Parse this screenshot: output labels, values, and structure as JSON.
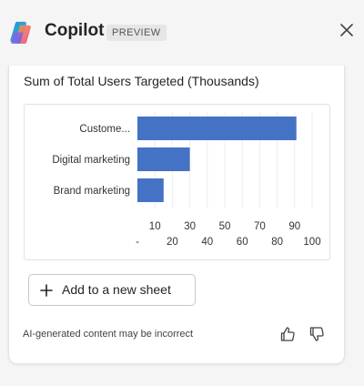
{
  "header": {
    "title": "Copilot",
    "badge": "PREVIEW",
    "icons": {
      "logo": "copilot-logo",
      "close": "close-icon"
    }
  },
  "chart_section": {
    "title": "Sum of Total Users Targeted (Thousands)"
  },
  "chart_data": {
    "type": "bar",
    "orientation": "horizontal",
    "title": "Sum of Total Users Targeted (Thousands)",
    "categories": [
      "Custome...",
      "Digital marketing",
      "Brand marketing"
    ],
    "values": [
      91,
      30,
      15
    ],
    "xlim": [
      0,
      100
    ],
    "x_ticks_row1": [
      "10",
      "30",
      "50",
      "70",
      "90"
    ],
    "x_ticks_row2": [
      "-",
      "20",
      "40",
      "60",
      "80",
      "100"
    ],
    "bar_color": "#4472c4",
    "grid": true
  },
  "actions": {
    "add_to_sheet": "Add to a new sheet",
    "add_icon": "plus-icon"
  },
  "footer": {
    "disclaimer": "AI-generated content may be incorrect",
    "icons": {
      "like": "thumbs-up-icon",
      "dislike": "thumbs-down-icon"
    }
  }
}
